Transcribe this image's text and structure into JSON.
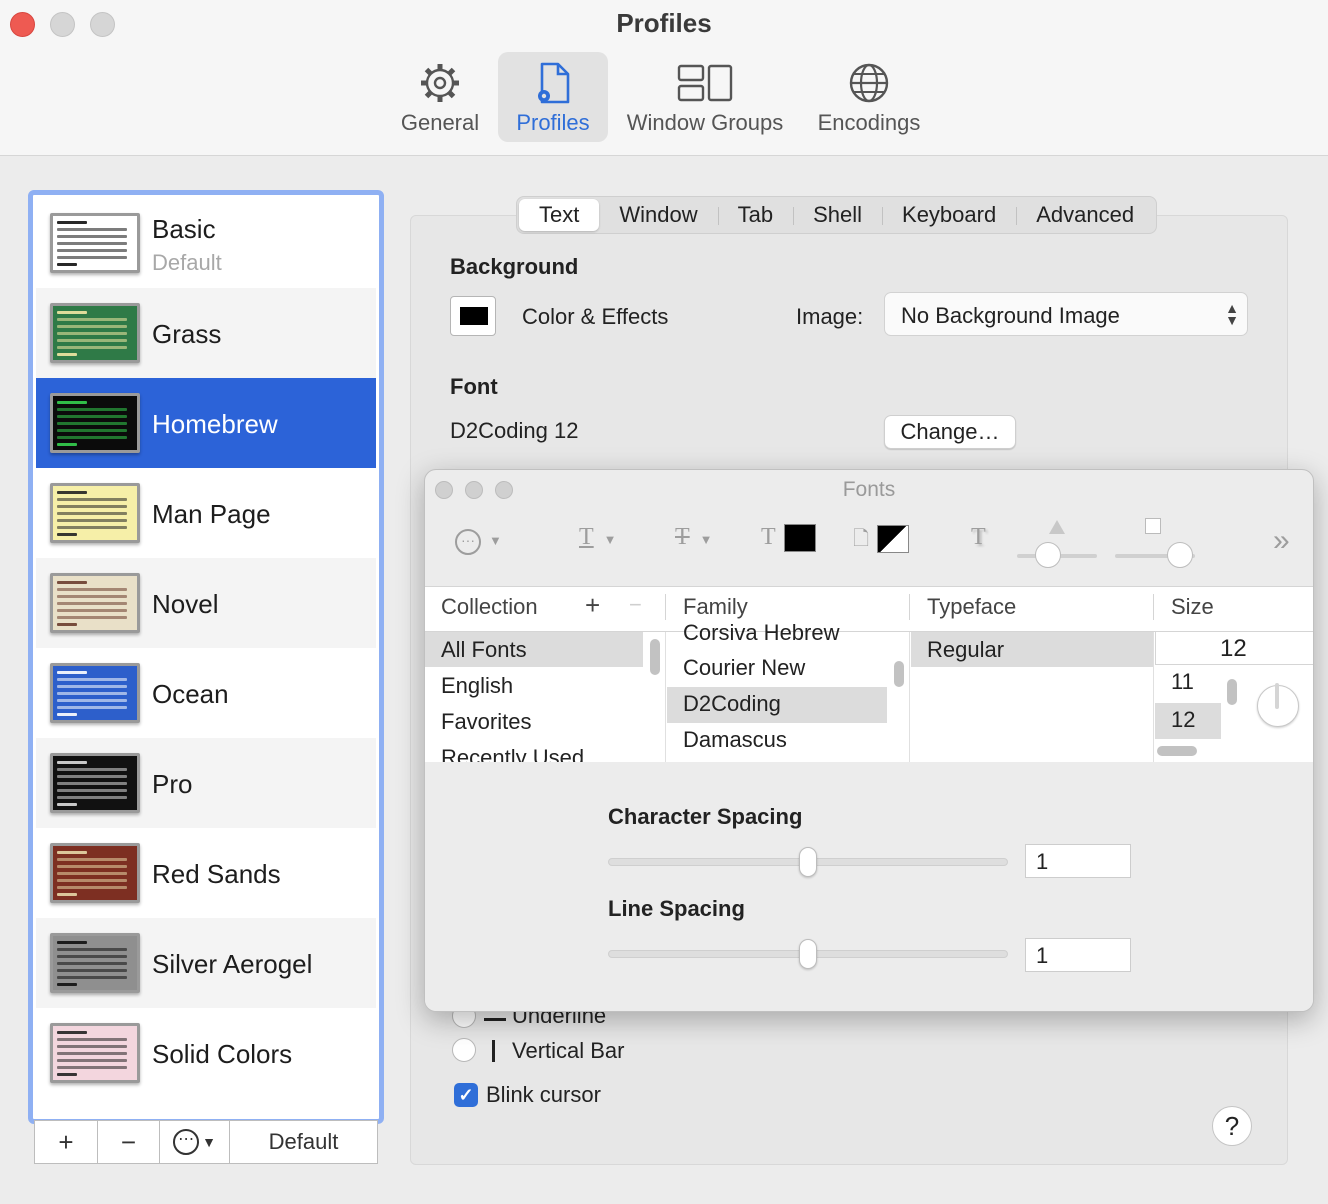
{
  "window": {
    "title": "Profiles"
  },
  "toolbar": {
    "items": [
      {
        "label": "General",
        "icon": "gear-icon"
      },
      {
        "label": "Profiles",
        "icon": "profiles-doc-icon"
      },
      {
        "label": "Window Groups",
        "icon": "window-groups-icon"
      },
      {
        "label": "Encodings",
        "icon": "globe-icon"
      }
    ],
    "active": "Profiles"
  },
  "profiles": {
    "items": [
      {
        "name": "Basic",
        "subtitle": "Default",
        "bg": "#ffffff",
        "fg": "#111111"
      },
      {
        "name": "Grass",
        "bg": "#2f7a47",
        "fg": "#f3e7a3"
      },
      {
        "name": "Homebrew",
        "bg": "#0b0b0b",
        "fg": "#35d04f"
      },
      {
        "name": "Man Page",
        "bg": "#f6efa8",
        "fg": "#222222"
      },
      {
        "name": "Novel",
        "bg": "#e9e0c8",
        "fg": "#6b3d2e"
      },
      {
        "name": "Ocean",
        "bg": "#2d5fcb",
        "fg": "#ffffff"
      },
      {
        "name": "Pro",
        "bg": "#111111",
        "fg": "#dddddd"
      },
      {
        "name": "Red Sands",
        "bg": "#7d2f22",
        "fg": "#e7d7a8"
      },
      {
        "name": "Silver Aerogel",
        "bg": "#8f8f8f",
        "fg": "#111111"
      },
      {
        "name": "Solid Colors",
        "bg": "#f3d6de",
        "fg": "#222222"
      }
    ],
    "selected": "Homebrew",
    "buttons": {
      "add": "+",
      "remove": "−",
      "more": "⋯",
      "default": "Default"
    }
  },
  "tabs": [
    "Text",
    "Window",
    "Tab",
    "Shell",
    "Keyboard",
    "Advanced"
  ],
  "active_tab": "Text",
  "text_settings": {
    "background_heading": "Background",
    "color_effects_label": "Color & Effects",
    "image_label": "Image:",
    "image_value": "No Background Image",
    "font_heading": "Font",
    "font_value": "D2Coding 12",
    "change_button": "Change…",
    "cursor_underline": "Underline",
    "cursor_vertical_bar": "Vertical Bar",
    "blink_cursor_label": "Blink cursor",
    "blink_cursor_checked": true,
    "help": "?"
  },
  "fonts_panel": {
    "title": "Fonts",
    "columns": {
      "collection": "Collection",
      "family": "Family",
      "typeface": "Typeface",
      "size": "Size"
    },
    "collections": [
      "All Fonts",
      "English",
      "Favorites",
      "Recently Used"
    ],
    "selected_collection": "All Fonts",
    "families": [
      "Corsiva Hebrew",
      "Courier New",
      "D2Coding",
      "Damascus"
    ],
    "selected_family": "D2Coding",
    "typefaces": [
      "Regular"
    ],
    "selected_typeface": "Regular",
    "size_field": "12",
    "sizes": [
      "11",
      "12"
    ],
    "selected_size": "12",
    "character_spacing_label": "Character Spacing",
    "character_spacing_value": "1",
    "character_spacing_level": 0.5,
    "line_spacing_label": "Line Spacing",
    "line_spacing_value": "1",
    "line_spacing_level": 0.5
  }
}
